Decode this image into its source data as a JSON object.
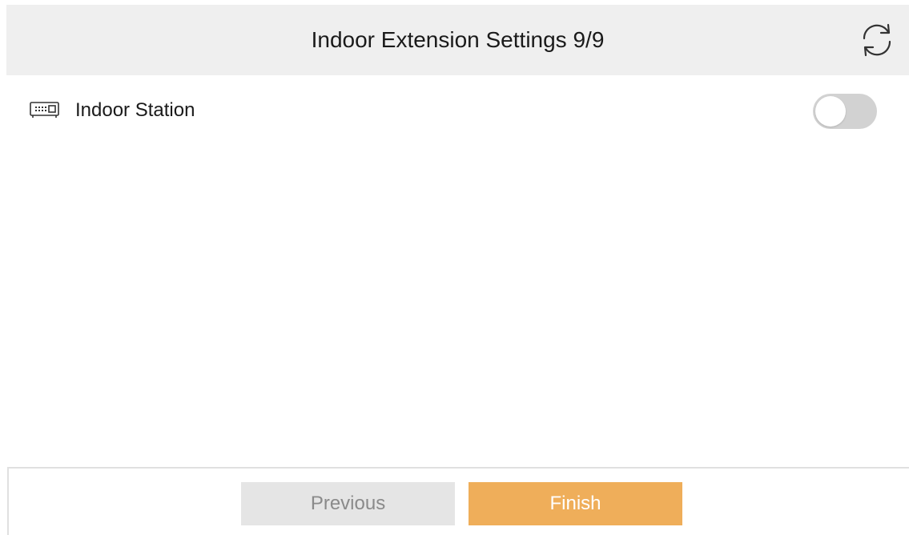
{
  "header": {
    "title": "Indoor Extension Settings 9/9",
    "refresh_icon": "refresh-icon"
  },
  "settings": {
    "items": [
      {
        "icon": "indoor-station-icon",
        "label": "Indoor Station",
        "enabled": false
      }
    ]
  },
  "footer": {
    "previous_label": "Previous",
    "finish_label": "Finish"
  },
  "colors": {
    "header_bg": "#efefef",
    "accent": "#efae5a",
    "toggle_off": "#d2d2d2",
    "secondary_button_bg": "#e5e5e5",
    "secondary_button_text": "#8a8a8a"
  }
}
